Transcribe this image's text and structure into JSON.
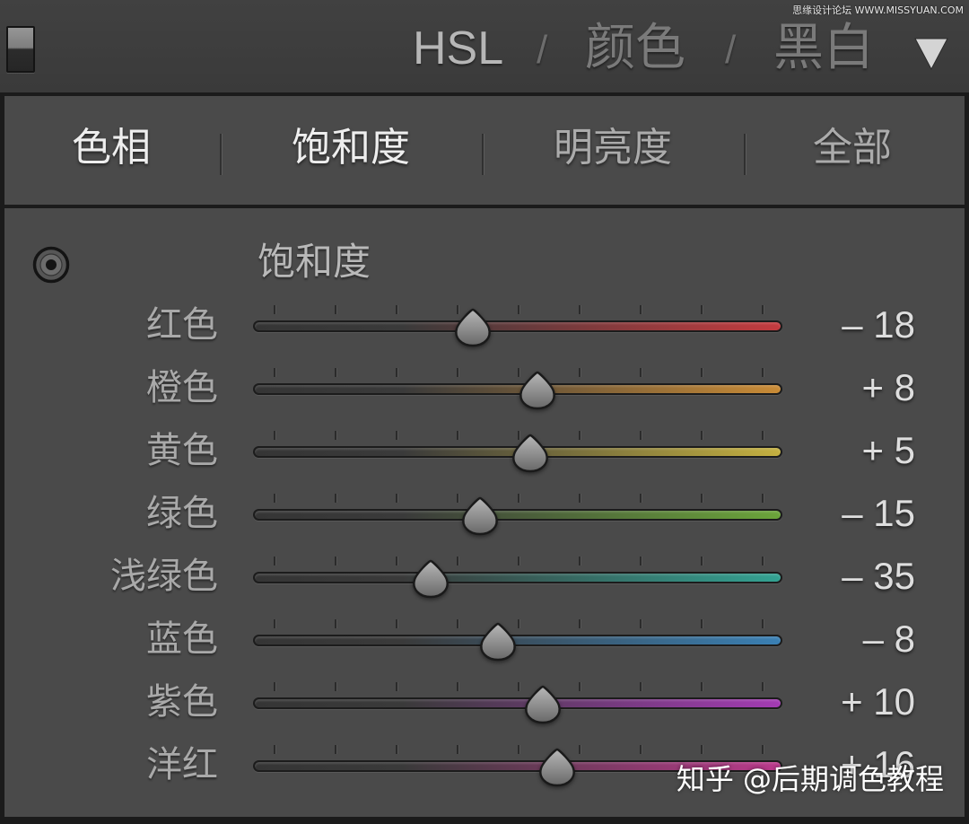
{
  "header": {
    "toggle_icon": "panel-toggle-icon",
    "title_hsl": "HSL",
    "separator_1": "/",
    "title_color": "颜色",
    "separator_2": "/",
    "title_bw": "黑白",
    "menu_icon": "triangle-down-icon"
  },
  "watermark_top": "思缘设计论坛 WWW.MISSYUAN.COM",
  "tabs": [
    {
      "label": "色相"
    },
    {
      "label": "饱和度"
    },
    {
      "label": "明亮度"
    },
    {
      "label": "全部"
    }
  ],
  "section": {
    "target_icon": "target-adjustment-icon",
    "title": "饱和度"
  },
  "sliders": [
    {
      "label": "红色",
      "value": -18,
      "value_text": "– 18",
      "color": "#c43b3f"
    },
    {
      "label": "橙色",
      "value": 8,
      "value_text": "+ 8",
      "color": "#c98b36"
    },
    {
      "label": "黄色",
      "value": 5,
      "value_text": "+ 5",
      "color": "#c4b040"
    },
    {
      "label": "绿色",
      "value": -15,
      "value_text": "– 15",
      "color": "#6ba53a"
    },
    {
      "label": "浅绿色",
      "value": -35,
      "value_text": "– 35",
      "color": "#33a292"
    },
    {
      "label": "蓝色",
      "value": -8,
      "value_text": "– 8",
      "color": "#3a80b4"
    },
    {
      "label": "紫色",
      "value": 10,
      "value_text": "+ 10",
      "color": "#a43bb4"
    },
    {
      "label": "洋红",
      "value": 16,
      "value_text": "+ 16",
      "color": "#bb3a8c"
    }
  ],
  "watermark_bottom": "知乎 @后期调色教程"
}
